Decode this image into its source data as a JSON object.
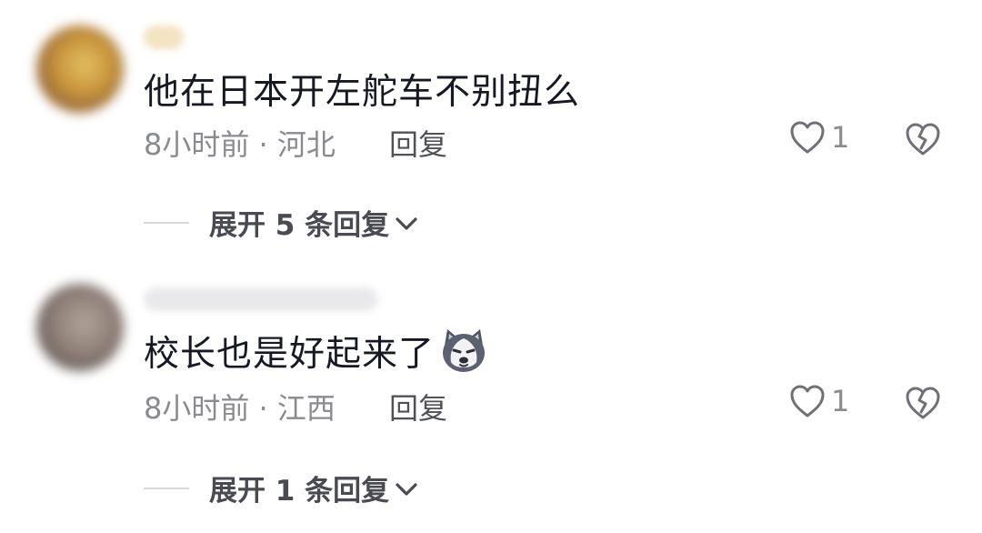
{
  "comments": [
    {
      "text": "他在日本开左舵车不别扭么",
      "meta": "8小时前 · 河北",
      "reply_label": "回复",
      "like_count": "1",
      "expand_label": "展开 5 条回复"
    },
    {
      "text": "校长也是好起来了",
      "emoji": "husky-dog-face-emoji",
      "meta": "8小时前 · 江西",
      "reply_label": "回复",
      "like_count": "1",
      "expand_label": "展开 1 条回复"
    }
  ],
  "icons": {
    "like": "heart-outline-icon",
    "dislike": "broken-heart-icon",
    "expand": "chevron-down-icon"
  },
  "colors": {
    "text": "#161823",
    "meta": "#8a8b91",
    "background": "#ffffff"
  }
}
